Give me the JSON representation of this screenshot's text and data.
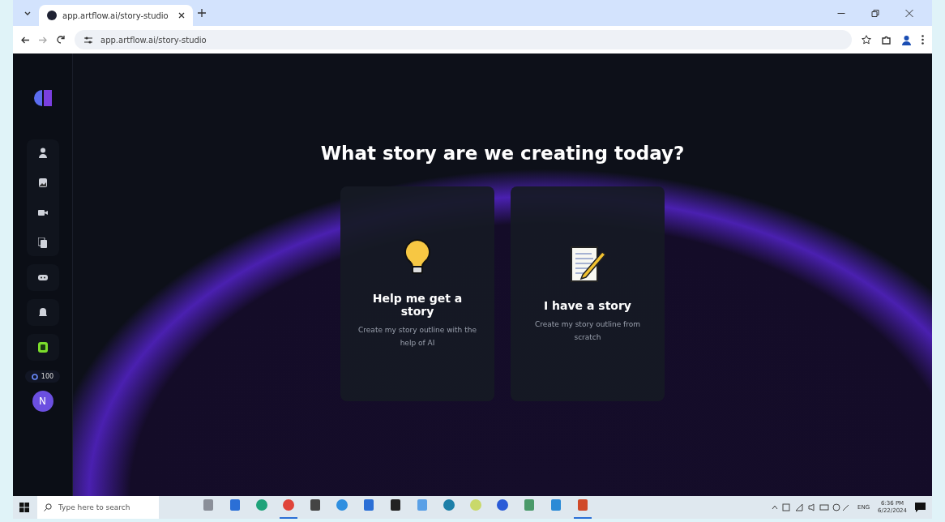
{
  "browser": {
    "tabs": [
      {
        "title": "app.artflow.ai/story-studio",
        "selected": true
      }
    ],
    "url": "app.artflow.ai/story-studio"
  },
  "sidebar": {
    "groups": [
      {
        "items": [
          {
            "kind": "user"
          },
          {
            "kind": "image"
          },
          {
            "kind": "video"
          },
          {
            "kind": "copy"
          }
        ]
      },
      {
        "items": [
          {
            "kind": "gamepad"
          }
        ]
      },
      {
        "items": [
          {
            "kind": "bell"
          }
        ]
      },
      {
        "items": [
          {
            "kind": "badge"
          }
        ]
      }
    ],
    "credits": "100",
    "avatar": "N"
  },
  "heading": "What story are we creating today?",
  "cards": [
    {
      "kind": "bulb",
      "title": "Help me get a story",
      "description": "Create my story outline with the help of AI"
    },
    {
      "kind": "memo",
      "title": "I have a story",
      "description": "Create my story outline from scratch"
    }
  ],
  "taskbar": {
    "search_placeholder": "Type here to search",
    "apps": [
      {
        "kind": "widget",
        "active": false
      },
      {
        "kind": "doc",
        "active": false
      },
      {
        "kind": "edge",
        "active": false
      },
      {
        "kind": "chrome",
        "active": true
      },
      {
        "kind": "store",
        "active": false
      },
      {
        "kind": "chat",
        "active": false
      },
      {
        "kind": "doc",
        "active": false
      },
      {
        "kind": "phone",
        "active": false
      },
      {
        "kind": "folder",
        "active": false
      },
      {
        "kind": "globe",
        "active": false
      },
      {
        "kind": "circle",
        "active": false
      },
      {
        "kind": "meet",
        "active": false
      },
      {
        "kind": "pen",
        "active": false
      },
      {
        "kind": "mail",
        "active": false
      },
      {
        "kind": "slides",
        "active": true
      }
    ],
    "language": "ENG",
    "time": "6:36 PM",
    "date": "6/22/2024"
  }
}
